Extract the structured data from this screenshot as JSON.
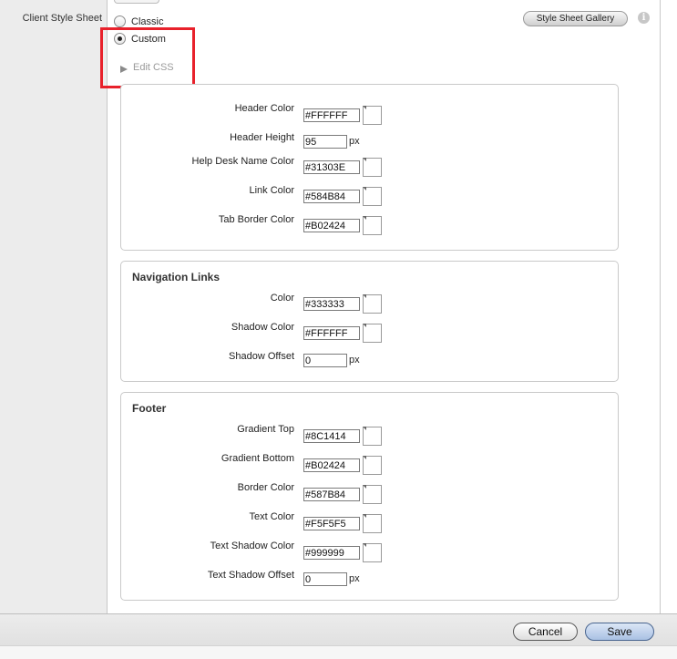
{
  "left": {
    "label": "Client Style Sheet"
  },
  "style_options": [
    {
      "label": "Classic",
      "selected": false
    },
    {
      "label": "Custom",
      "selected": true
    }
  ],
  "gallery_button": "Style Sheet Gallery",
  "info_icon": "i",
  "edit_css": "Edit CSS",
  "header_panel": {
    "fields": [
      {
        "label": "Header Color",
        "value": "#FFFFFF",
        "swatch": "#FFFFFF"
      },
      {
        "label": "Header Height",
        "value": "95",
        "unit": "px"
      },
      {
        "label": "Help Desk Name Color",
        "value": "#31303E",
        "swatch": "#31303E"
      },
      {
        "label": "Link Color",
        "value": "#584B84",
        "swatch": "#584B84"
      },
      {
        "label": "Tab Border Color",
        "value": "#B02424",
        "swatch": "#B02424"
      }
    ]
  },
  "nav_panel": {
    "title": "Navigation Links",
    "fields": [
      {
        "label": "Color",
        "value": "#333333",
        "swatch": "#333333"
      },
      {
        "label": "Shadow Color",
        "value": "#FFFFFF",
        "swatch": "#FFFFFF"
      },
      {
        "label": "Shadow Offset",
        "value": "0",
        "unit": "px"
      }
    ]
  },
  "footer_panel": {
    "title": "Footer",
    "fields": [
      {
        "label": "Gradient Top",
        "value": "#8C1414",
        "swatch": "#8C1414"
      },
      {
        "label": "Gradient Bottom",
        "value": "#B02424",
        "swatch": "#B02424"
      },
      {
        "label": "Border Color",
        "value": "#587B84",
        "swatch": "#587B84"
      },
      {
        "label": "Text Color",
        "value": "#F5F5F5",
        "swatch": "#F5F5F5"
      },
      {
        "label": "Text Shadow Color",
        "value": "#999999",
        "swatch": "#999999"
      },
      {
        "label": "Text Shadow Offset",
        "value": "0",
        "unit": "px"
      }
    ]
  },
  "buttons": {
    "cancel": "Cancel",
    "save": "Save"
  },
  "colors": {
    "highlight": "#E8212B",
    "save_button": "#A9C1E3"
  }
}
